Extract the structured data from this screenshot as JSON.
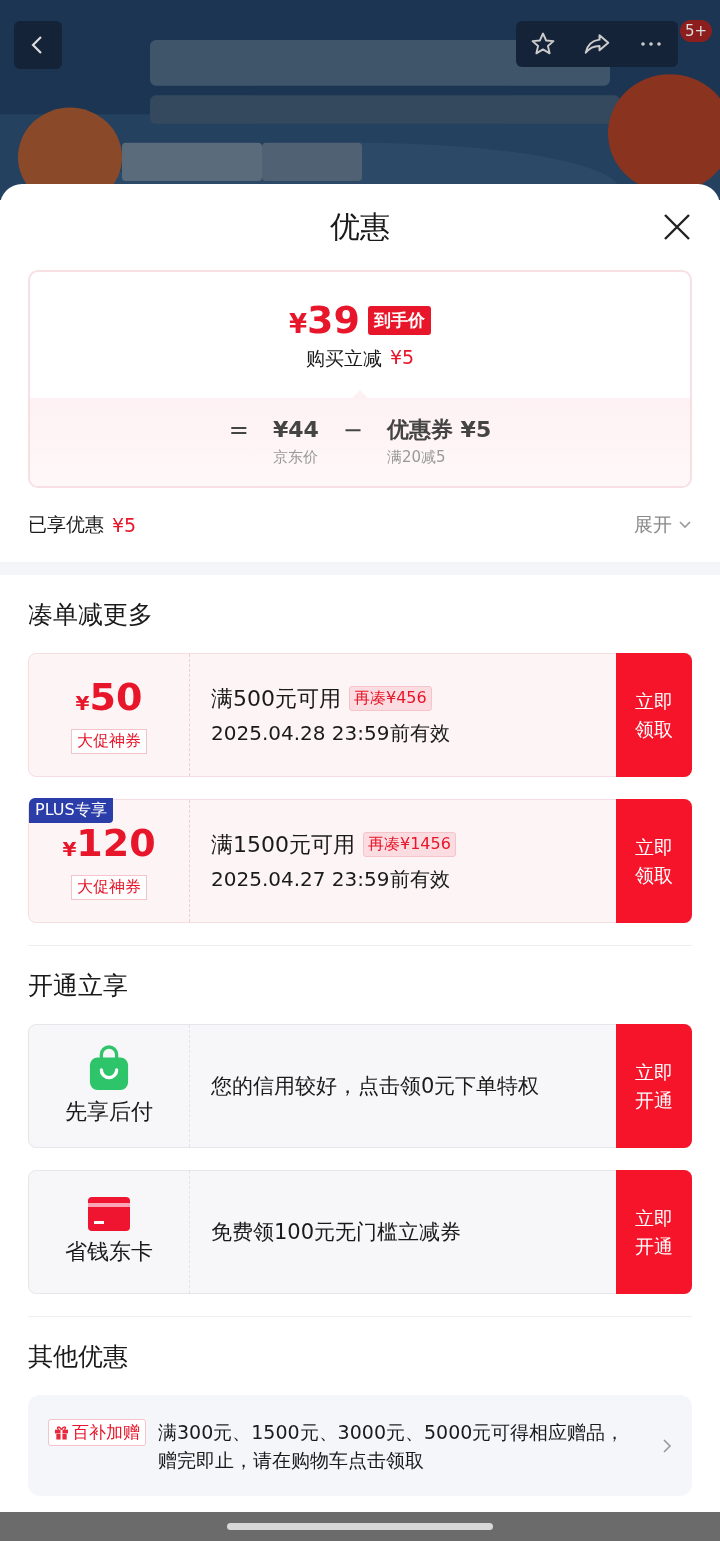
{
  "header": {
    "badge": "5+"
  },
  "sheet": {
    "title": "优惠"
  },
  "price_card": {
    "price_symbol": "¥",
    "price": "39",
    "price_tag": "到手价",
    "instant_label": "购买立减",
    "instant_amount": "¥5",
    "equals": "=",
    "base_price": "¥44",
    "base_label": "京东价",
    "minus": "−",
    "coupon_label": "优惠券 ¥5",
    "coupon_rule": "满20减5"
  },
  "enjoyed": {
    "label": "已享优惠",
    "amount": "¥5",
    "expand": "展开"
  },
  "coupon_section": {
    "title": "凑单减更多",
    "coupons": [
      {
        "symbol": "¥",
        "amount": "50",
        "tag": "大促神券",
        "condition": "满500元可用",
        "gap": "再凑¥456",
        "validity": "2025.04.28 23:59前有效",
        "button": "立即领取"
      },
      {
        "plus_badge": "PLUS专享",
        "symbol": "¥",
        "amount": "120",
        "tag": "大促神券",
        "condition": "满1500元可用",
        "gap": "再凑¥1456",
        "validity": "2025.04.27 23:59前有效",
        "button": "立即领取"
      }
    ]
  },
  "service_section": {
    "title": "开通立享",
    "services": [
      {
        "kind": "bag",
        "name": "先享后付",
        "description": "您的信用较好，点击领0元下单特权",
        "button": "立即开通"
      },
      {
        "kind": "card",
        "name": "省钱东卡",
        "description": "免费领100元无门槛立减券",
        "button": "立即开通"
      }
    ]
  },
  "other_section": {
    "title": "其他优惠",
    "offers": [
      {
        "tag": "百补加赠",
        "text": "满300元、1500元、3000元、5000元可得相应赠品，赠完即止，请在购物车点击领取"
      }
    ]
  }
}
